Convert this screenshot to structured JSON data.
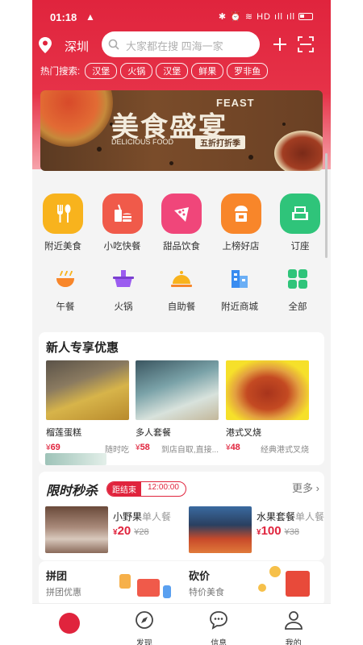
{
  "status": {
    "time": "01:18",
    "warning": "▲",
    "right_icons": "✱ ⏰ ≋ HD ıll ıll"
  },
  "header": {
    "city": "深圳",
    "search_placeholder": "大家都在搜  四海一家",
    "hot_label": "热门搜索:",
    "hot_tags": [
      "汉堡",
      "火锅",
      "汉堡",
      "鲜果",
      "罗非鱼"
    ]
  },
  "banner": {
    "title": "美食盛宴",
    "feast": "FEAST",
    "sub": "DELICIOUS FOOD",
    "badge": "五折打折季"
  },
  "categories_main": [
    {
      "label": "附近美食",
      "icon": "fork-knife-icon",
      "color": "#f8b31d"
    },
    {
      "label": "小吃快餐",
      "icon": "fast-food-icon",
      "color": "#f05a4a"
    },
    {
      "label": "甜品饮食",
      "icon": "cake-icon",
      "color": "#f0467a"
    },
    {
      "label": "上榜好店",
      "icon": "store-icon",
      "color": "#f8862a"
    },
    {
      "label": "订座",
      "icon": "seat-icon",
      "color": "#2fc47a"
    }
  ],
  "categories_sub": [
    {
      "label": "午餐",
      "icon": "bowl-icon",
      "color": "#f8862a"
    },
    {
      "label": "火锅",
      "icon": "hotpot-icon",
      "color": "#9b5cf0"
    },
    {
      "label": "自助餐",
      "icon": "cloche-icon",
      "color": "#f8b31d"
    },
    {
      "label": "附近商城",
      "icon": "building-icon",
      "color": "#3a8cf0"
    },
    {
      "label": "全部",
      "icon": "grid-icon",
      "color": "#2fc47a"
    }
  ],
  "new_user": {
    "title": "新人专享优惠",
    "items": [
      {
        "name": "榴莲蛋糕",
        "price": "69",
        "desc": "随时吃"
      },
      {
        "name": "多人套餐",
        "price": "58",
        "desc": "到店自取,直接..."
      },
      {
        "name": "港式叉烧",
        "price": "48",
        "desc": "经典港式叉烧"
      }
    ],
    "currency": "¥"
  },
  "flash": {
    "logo": "限时秒杀",
    "end_label": "距结束",
    "countdown": "12:00:00",
    "more": "更多",
    "deals": [
      {
        "name": "小野果",
        "tag": "单人餐",
        "price": "20",
        "old": "¥28"
      },
      {
        "name": "水果套餐",
        "tag": "单人餐",
        "price": "100",
        "old": "¥38"
      }
    ]
  },
  "group": {
    "left_title": "拼团",
    "left_sub": "拼团优惠",
    "right_title": "砍价",
    "right_sub": "特价美食"
  },
  "tabbar": [
    {
      "label": "",
      "icon": "home-logo-icon"
    },
    {
      "label": "发现",
      "icon": "compass-icon"
    },
    {
      "label": "信息",
      "icon": "message-icon"
    },
    {
      "label": "我的",
      "icon": "user-icon"
    }
  ]
}
